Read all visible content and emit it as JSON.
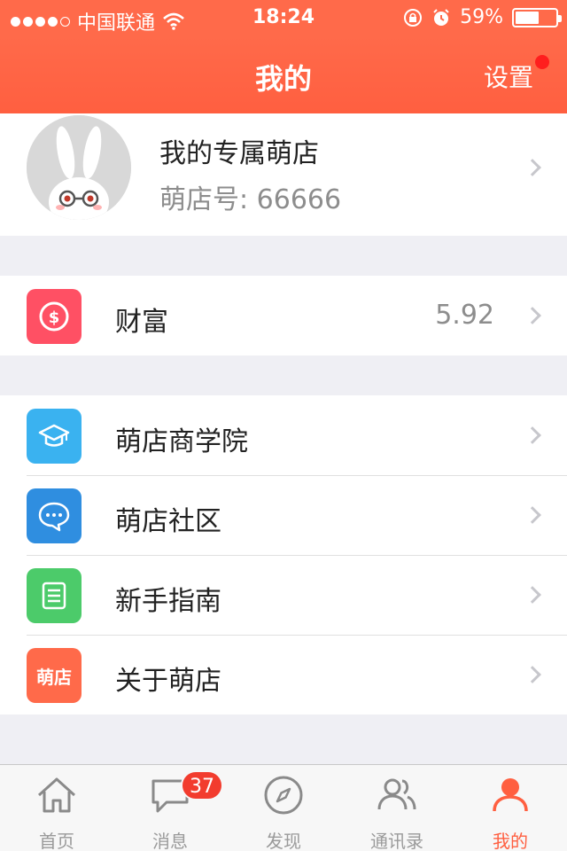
{
  "statusbar": {
    "carrier": "中国联通",
    "time": "18:24",
    "battery_text": "59%",
    "battery_level": 0.59
  },
  "header": {
    "title": "我的",
    "settings_label": "设置"
  },
  "profile": {
    "name": "我的专属萌店",
    "shop_id": "萌店号: 66666"
  },
  "wealth": {
    "label": "财富",
    "value": "5.92",
    "icon": "dollar-icon",
    "color": "#ff5064"
  },
  "menu": [
    {
      "label": "萌店商学院",
      "icon": "graduation-cap-icon",
      "color": "#3ab2f0"
    },
    {
      "label": "萌店社区",
      "icon": "chat-bubble-icon",
      "color": "#2f8ee0"
    },
    {
      "label": "新手指南",
      "icon": "document-icon",
      "color": "#4ccb6a"
    },
    {
      "label": "关于萌店",
      "icon": "brand-logo-icon",
      "icon_text": "萌店",
      "color": "#ff6a4a"
    }
  ],
  "tabbar": {
    "tabs": [
      {
        "label": "首页",
        "icon": "home-icon"
      },
      {
        "label": "消息",
        "icon": "message-icon",
        "badge": "37"
      },
      {
        "label": "发现",
        "icon": "compass-icon"
      },
      {
        "label": "通讯录",
        "icon": "contacts-icon"
      },
      {
        "label": "我的",
        "icon": "person-icon",
        "active": true
      }
    ]
  },
  "colors": {
    "accent": "#ff6a4a",
    "badge": "#f23c2e"
  }
}
